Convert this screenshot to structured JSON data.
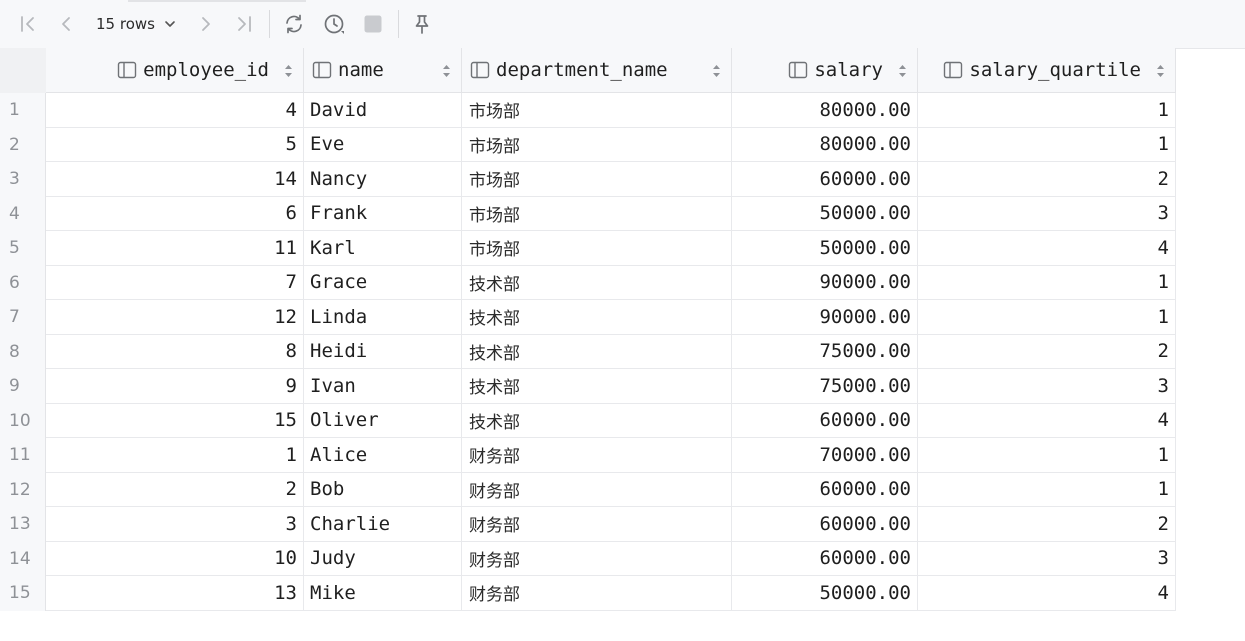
{
  "toolbar": {
    "rows_label": "15 rows",
    "buttons": [
      {
        "name": "first-page-button",
        "icon": "first-page-icon"
      },
      {
        "name": "prev-page-button",
        "icon": "chevron-left-icon"
      },
      {
        "name": "next-page-button",
        "icon": "chevron-right-icon"
      },
      {
        "name": "last-page-button",
        "icon": "last-page-icon"
      },
      {
        "name": "reload-button",
        "icon": "refresh-icon"
      },
      {
        "name": "history-button",
        "icon": "clock-icon"
      },
      {
        "name": "stop-button",
        "icon": "stop-icon"
      },
      {
        "name": "pin-button",
        "icon": "pin-icon"
      }
    ]
  },
  "table": {
    "columns": [
      "employee_id",
      "name",
      "department_name",
      "salary",
      "salary_quartile"
    ],
    "rows": [
      {
        "n": "1",
        "employee_id": "4",
        "name": "David",
        "department_name": "市场部",
        "salary": "80000.00",
        "salary_quartile": "1"
      },
      {
        "n": "2",
        "employee_id": "5",
        "name": "Eve",
        "department_name": "市场部",
        "salary": "80000.00",
        "salary_quartile": "1"
      },
      {
        "n": "3",
        "employee_id": "14",
        "name": "Nancy",
        "department_name": "市场部",
        "salary": "60000.00",
        "salary_quartile": "2"
      },
      {
        "n": "4",
        "employee_id": "6",
        "name": "Frank",
        "department_name": "市场部",
        "salary": "50000.00",
        "salary_quartile": "3"
      },
      {
        "n": "5",
        "employee_id": "11",
        "name": "Karl",
        "department_name": "市场部",
        "salary": "50000.00",
        "salary_quartile": "4"
      },
      {
        "n": "6",
        "employee_id": "7",
        "name": "Grace",
        "department_name": "技术部",
        "salary": "90000.00",
        "salary_quartile": "1"
      },
      {
        "n": "7",
        "employee_id": "12",
        "name": "Linda",
        "department_name": "技术部",
        "salary": "90000.00",
        "salary_quartile": "1"
      },
      {
        "n": "8",
        "employee_id": "8",
        "name": "Heidi",
        "department_name": "技术部",
        "salary": "75000.00",
        "salary_quartile": "2"
      },
      {
        "n": "9",
        "employee_id": "9",
        "name": "Ivan",
        "department_name": "技术部",
        "salary": "75000.00",
        "salary_quartile": "3"
      },
      {
        "n": "10",
        "employee_id": "15",
        "name": "Oliver",
        "department_name": "技术部",
        "salary": "60000.00",
        "salary_quartile": "4"
      },
      {
        "n": "11",
        "employee_id": "1",
        "name": "Alice",
        "department_name": "财务部",
        "salary": "70000.00",
        "salary_quartile": "1"
      },
      {
        "n": "12",
        "employee_id": "2",
        "name": "Bob",
        "department_name": "财务部",
        "salary": "60000.00",
        "salary_quartile": "1"
      },
      {
        "n": "13",
        "employee_id": "3",
        "name": "Charlie",
        "department_name": "财务部",
        "salary": "60000.00",
        "salary_quartile": "2"
      },
      {
        "n": "14",
        "employee_id": "10",
        "name": "Judy",
        "department_name": "财务部",
        "salary": "60000.00",
        "salary_quartile": "3"
      },
      {
        "n": "15",
        "employee_id": "13",
        "name": "Mike",
        "department_name": "财务部",
        "salary": "50000.00",
        "salary_quartile": "4"
      }
    ]
  }
}
